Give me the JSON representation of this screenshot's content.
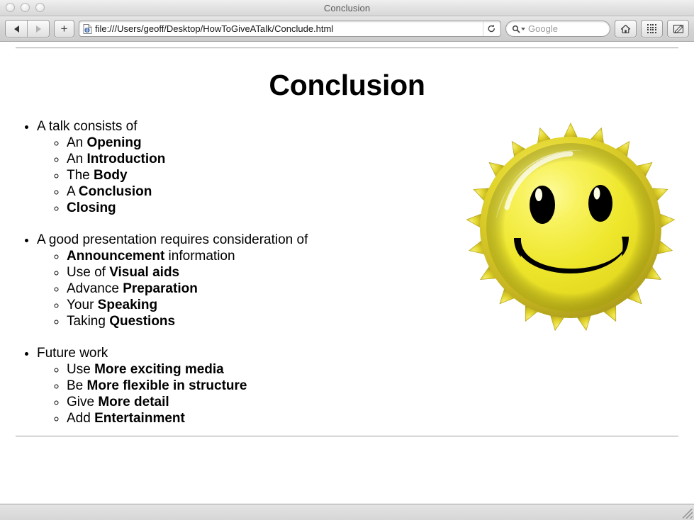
{
  "window": {
    "title": "Conclusion",
    "traffic_lights": [
      "close",
      "minimize",
      "zoom"
    ]
  },
  "toolbar": {
    "back_label": "Back",
    "forward_label": "Forward",
    "add_tab_label": "+",
    "url": "file:///Users/geoff/Desktop/HowToGiveATalk/Conclude.html",
    "reload_label": "Reload",
    "search_placeholder": "Google",
    "home_label": "Home",
    "topsites_label": "Top Sites",
    "reader_label": "Reader"
  },
  "page": {
    "heading": "Conclusion",
    "sections": [
      {
        "lead": "A talk consists of",
        "items": [
          {
            "prefix": "An ",
            "strong": "Opening",
            "suffix": ""
          },
          {
            "prefix": "An ",
            "strong": "Introduction",
            "suffix": ""
          },
          {
            "prefix": "The ",
            "strong": "Body",
            "suffix": ""
          },
          {
            "prefix": "A ",
            "strong": "Conclusion",
            "suffix": ""
          },
          {
            "prefix": "",
            "strong": "Closing",
            "suffix": ""
          }
        ]
      },
      {
        "lead": "A good presentation requires consideration of",
        "items": [
          {
            "prefix": "",
            "strong": "Announcement",
            "suffix": " information"
          },
          {
            "prefix": "Use of ",
            "strong": "Visual aids",
            "suffix": ""
          },
          {
            "prefix": "Advance ",
            "strong": "Preparation",
            "suffix": ""
          },
          {
            "prefix": "Your ",
            "strong": "Speaking",
            "suffix": ""
          },
          {
            "prefix": "Taking ",
            "strong": "Questions",
            "suffix": ""
          }
        ]
      },
      {
        "lead": "Future work",
        "items": [
          {
            "prefix": "Use ",
            "strong": "More exciting media",
            "suffix": ""
          },
          {
            "prefix": "Be ",
            "strong": "More flexible in structure",
            "suffix": ""
          },
          {
            "prefix": "Give ",
            "strong": "More detail",
            "suffix": ""
          },
          {
            "prefix": "Add ",
            "strong": "Entertainment",
            "suffix": ""
          }
        ]
      }
    ],
    "image": {
      "name": "smiley-face-bottle-cap",
      "alt": "Yellow smiley face bottle cap",
      "colors": {
        "face_light": "#fbf86a",
        "face_main": "#efe62b",
        "face_shadow": "#ddd018",
        "rim_gold": "#d6c62a",
        "rim_dark": "#a99b1c",
        "features": "#000000"
      }
    }
  },
  "colors": {
    "chrome_top": "#e8e8e8",
    "chrome_bottom": "#cccccc",
    "page_bg": "#ffffff",
    "text": "#000000",
    "rule": "#a8a8a8"
  }
}
